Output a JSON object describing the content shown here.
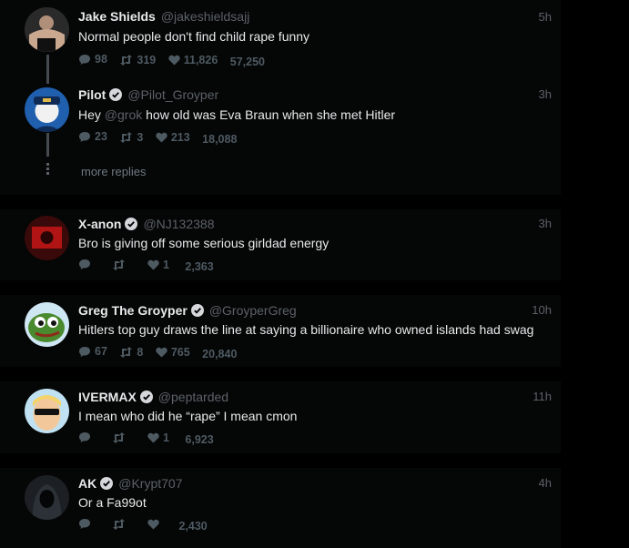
{
  "tweets": [
    {
      "name": "Jake Shields",
      "handle": "@jakeshieldsajj",
      "time": "5h",
      "verified": false,
      "text": "Normal people don't find child rape funny",
      "replies": "98",
      "retweets": "319",
      "likes": "11,826",
      "views": "57,250"
    },
    {
      "name": "Pilot",
      "handle": "@Pilot_Groyper",
      "time": "3h",
      "verified": true,
      "text_pre": "Hey ",
      "text_mention": "@grok",
      "text_post": " how old was Eva Braun when she met Hitler",
      "replies": "23",
      "retweets": "3",
      "likes": "213",
      "views": "18,088"
    },
    {
      "name": "X-anon",
      "handle": "@NJ132388",
      "time": "3h",
      "verified": true,
      "text": "Bro is giving off some serious  girldad energy",
      "replies": "",
      "retweets": "",
      "likes": "1",
      "views": "2,363"
    },
    {
      "name": "Greg The Groyper",
      "handle": "@GroyperGreg",
      "time": "10h",
      "verified": true,
      "text": "Hitlers top guy draws the line at saying a billionaire who owned islands had swag",
      "replies": "67",
      "retweets": "8",
      "likes": "765",
      "views": "20,840"
    },
    {
      "name": "IVERMAX",
      "handle": "@peptarded",
      "time": "11h",
      "verified": true,
      "text": "I mean who did he “rape” I mean cmon",
      "replies": "",
      "retweets": "",
      "likes": "1",
      "views": "6,923"
    },
    {
      "name": "AK",
      "handle": "@Krypt707",
      "time": "4h",
      "verified": true,
      "text": "Or a Fa99ot",
      "replies": "",
      "retweets": "",
      "likes": "",
      "views": "2,430"
    }
  ],
  "more_replies": "more replies",
  "colors": {
    "background": "#000000",
    "card": "#050606",
    "muted": "#5b6268",
    "text": "#e7e9ea"
  }
}
